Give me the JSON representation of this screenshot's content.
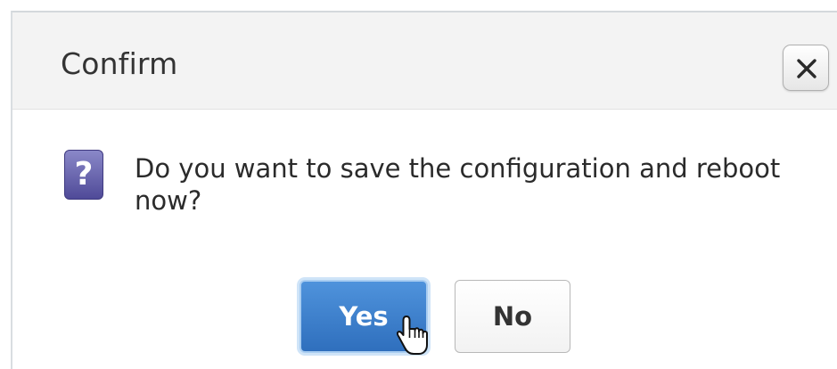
{
  "dialog": {
    "title": "Confirm",
    "close_icon": "close-icon",
    "message": "Do you want to save the configuration and reboot now?",
    "message_icon": "question-icon",
    "question_glyph": "?",
    "buttons": {
      "yes_label": "Yes",
      "no_label": "No"
    }
  },
  "colors": {
    "primary_button": "#3a7fcc",
    "icon_purple": "#5a55a3",
    "title_bar": "#f3f3f3"
  },
  "cursor": "hand-pointer-icon"
}
